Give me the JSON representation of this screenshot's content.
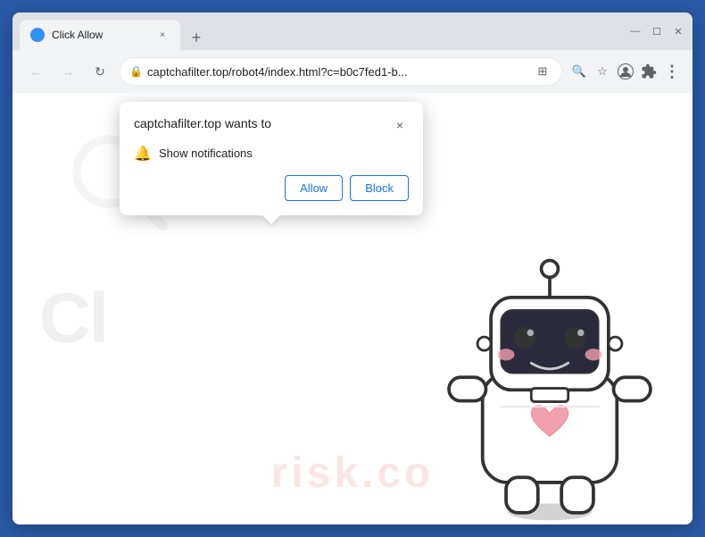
{
  "browser": {
    "tab": {
      "favicon": "🌐",
      "title": "Click Allow",
      "close_label": "×"
    },
    "new_tab_label": "+",
    "window_controls": {
      "minimize": "—",
      "maximize": "☐",
      "close": "✕"
    },
    "nav": {
      "back_label": "←",
      "forward_label": "→",
      "reload_label": "↻",
      "lock_icon": "🔒",
      "url": "captchafilter.top/robot4/index.html?c=b0c7fed1-b...",
      "translate_icon": "⊞",
      "search_icon": "🔍",
      "bookmark_icon": "☆",
      "profile_icon": "👤",
      "menu_icon": "⋮",
      "extensions_icon": "⊕"
    }
  },
  "popup": {
    "title": "captchafilter.top wants to",
    "close_label": "×",
    "permission_icon": "🔔",
    "permission_text": "Show notifications",
    "allow_label": "Allow",
    "block_label": "Block"
  },
  "page": {
    "bg_text": "Cl",
    "watermark": "risk.co",
    "robot_alt": "cute robot illustration"
  },
  "colors": {
    "browser_border": "#2a5ba8",
    "allow_btn": "#1a73e8",
    "block_btn": "#1a73e8"
  }
}
